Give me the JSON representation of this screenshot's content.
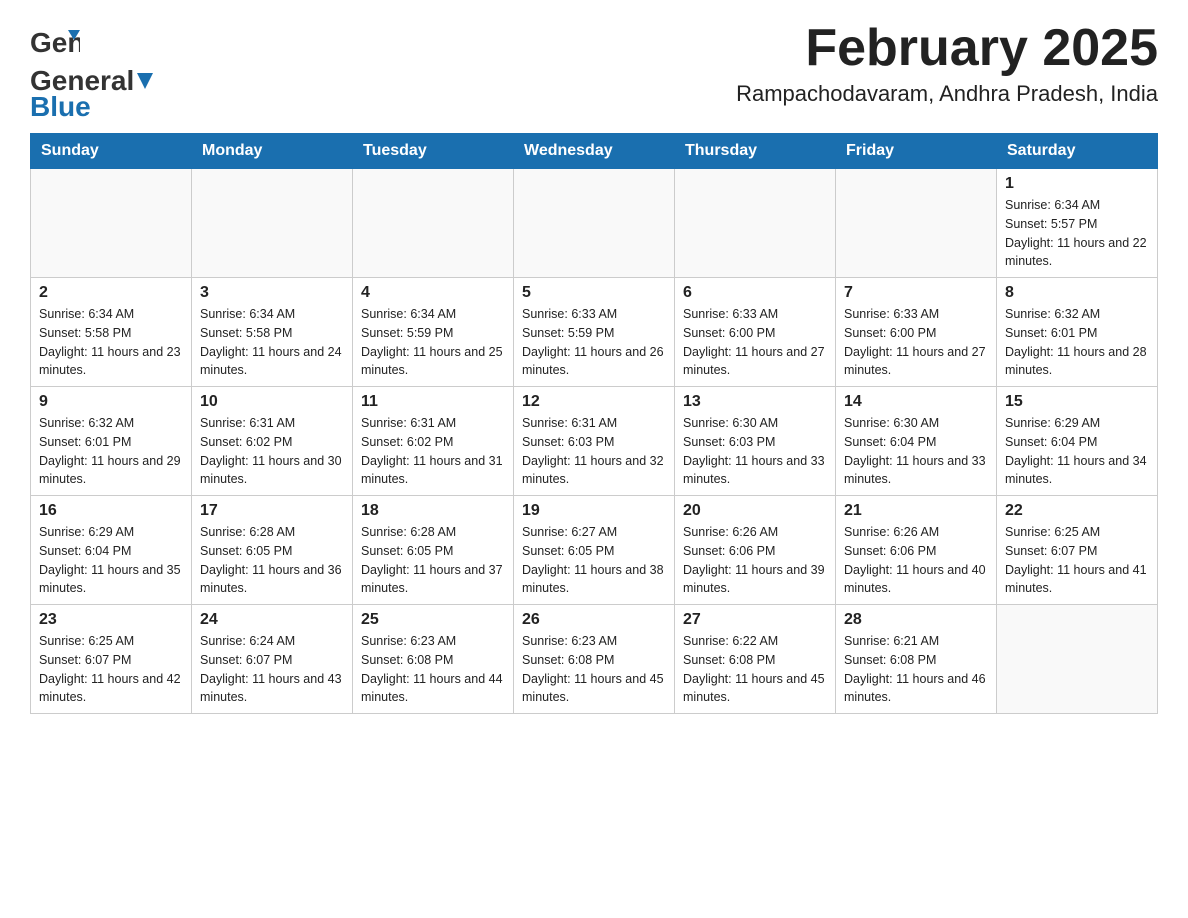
{
  "header": {
    "logo": {
      "part1": "General",
      "part2": "Blue"
    },
    "title": "February 2025",
    "location": "Rampachodavaram, Andhra Pradesh, India"
  },
  "days_of_week": [
    "Sunday",
    "Monday",
    "Tuesday",
    "Wednesday",
    "Thursday",
    "Friday",
    "Saturday"
  ],
  "weeks": [
    [
      {
        "day": "",
        "info": ""
      },
      {
        "day": "",
        "info": ""
      },
      {
        "day": "",
        "info": ""
      },
      {
        "day": "",
        "info": ""
      },
      {
        "day": "",
        "info": ""
      },
      {
        "day": "",
        "info": ""
      },
      {
        "day": "1",
        "info": "Sunrise: 6:34 AM\nSunset: 5:57 PM\nDaylight: 11 hours and 22 minutes."
      }
    ],
    [
      {
        "day": "2",
        "info": "Sunrise: 6:34 AM\nSunset: 5:58 PM\nDaylight: 11 hours and 23 minutes."
      },
      {
        "day": "3",
        "info": "Sunrise: 6:34 AM\nSunset: 5:58 PM\nDaylight: 11 hours and 24 minutes."
      },
      {
        "day": "4",
        "info": "Sunrise: 6:34 AM\nSunset: 5:59 PM\nDaylight: 11 hours and 25 minutes."
      },
      {
        "day": "5",
        "info": "Sunrise: 6:33 AM\nSunset: 5:59 PM\nDaylight: 11 hours and 26 minutes."
      },
      {
        "day": "6",
        "info": "Sunrise: 6:33 AM\nSunset: 6:00 PM\nDaylight: 11 hours and 27 minutes."
      },
      {
        "day": "7",
        "info": "Sunrise: 6:33 AM\nSunset: 6:00 PM\nDaylight: 11 hours and 27 minutes."
      },
      {
        "day": "8",
        "info": "Sunrise: 6:32 AM\nSunset: 6:01 PM\nDaylight: 11 hours and 28 minutes."
      }
    ],
    [
      {
        "day": "9",
        "info": "Sunrise: 6:32 AM\nSunset: 6:01 PM\nDaylight: 11 hours and 29 minutes."
      },
      {
        "day": "10",
        "info": "Sunrise: 6:31 AM\nSunset: 6:02 PM\nDaylight: 11 hours and 30 minutes."
      },
      {
        "day": "11",
        "info": "Sunrise: 6:31 AM\nSunset: 6:02 PM\nDaylight: 11 hours and 31 minutes."
      },
      {
        "day": "12",
        "info": "Sunrise: 6:31 AM\nSunset: 6:03 PM\nDaylight: 11 hours and 32 minutes."
      },
      {
        "day": "13",
        "info": "Sunrise: 6:30 AM\nSunset: 6:03 PM\nDaylight: 11 hours and 33 minutes."
      },
      {
        "day": "14",
        "info": "Sunrise: 6:30 AM\nSunset: 6:04 PM\nDaylight: 11 hours and 33 minutes."
      },
      {
        "day": "15",
        "info": "Sunrise: 6:29 AM\nSunset: 6:04 PM\nDaylight: 11 hours and 34 minutes."
      }
    ],
    [
      {
        "day": "16",
        "info": "Sunrise: 6:29 AM\nSunset: 6:04 PM\nDaylight: 11 hours and 35 minutes."
      },
      {
        "day": "17",
        "info": "Sunrise: 6:28 AM\nSunset: 6:05 PM\nDaylight: 11 hours and 36 minutes."
      },
      {
        "day": "18",
        "info": "Sunrise: 6:28 AM\nSunset: 6:05 PM\nDaylight: 11 hours and 37 minutes."
      },
      {
        "day": "19",
        "info": "Sunrise: 6:27 AM\nSunset: 6:05 PM\nDaylight: 11 hours and 38 minutes."
      },
      {
        "day": "20",
        "info": "Sunrise: 6:26 AM\nSunset: 6:06 PM\nDaylight: 11 hours and 39 minutes."
      },
      {
        "day": "21",
        "info": "Sunrise: 6:26 AM\nSunset: 6:06 PM\nDaylight: 11 hours and 40 minutes."
      },
      {
        "day": "22",
        "info": "Sunrise: 6:25 AM\nSunset: 6:07 PM\nDaylight: 11 hours and 41 minutes."
      }
    ],
    [
      {
        "day": "23",
        "info": "Sunrise: 6:25 AM\nSunset: 6:07 PM\nDaylight: 11 hours and 42 minutes."
      },
      {
        "day": "24",
        "info": "Sunrise: 6:24 AM\nSunset: 6:07 PM\nDaylight: 11 hours and 43 minutes."
      },
      {
        "day": "25",
        "info": "Sunrise: 6:23 AM\nSunset: 6:08 PM\nDaylight: 11 hours and 44 minutes."
      },
      {
        "day": "26",
        "info": "Sunrise: 6:23 AM\nSunset: 6:08 PM\nDaylight: 11 hours and 45 minutes."
      },
      {
        "day": "27",
        "info": "Sunrise: 6:22 AM\nSunset: 6:08 PM\nDaylight: 11 hours and 45 minutes."
      },
      {
        "day": "28",
        "info": "Sunrise: 6:21 AM\nSunset: 6:08 PM\nDaylight: 11 hours and 46 minutes."
      },
      {
        "day": "",
        "info": ""
      }
    ]
  ]
}
